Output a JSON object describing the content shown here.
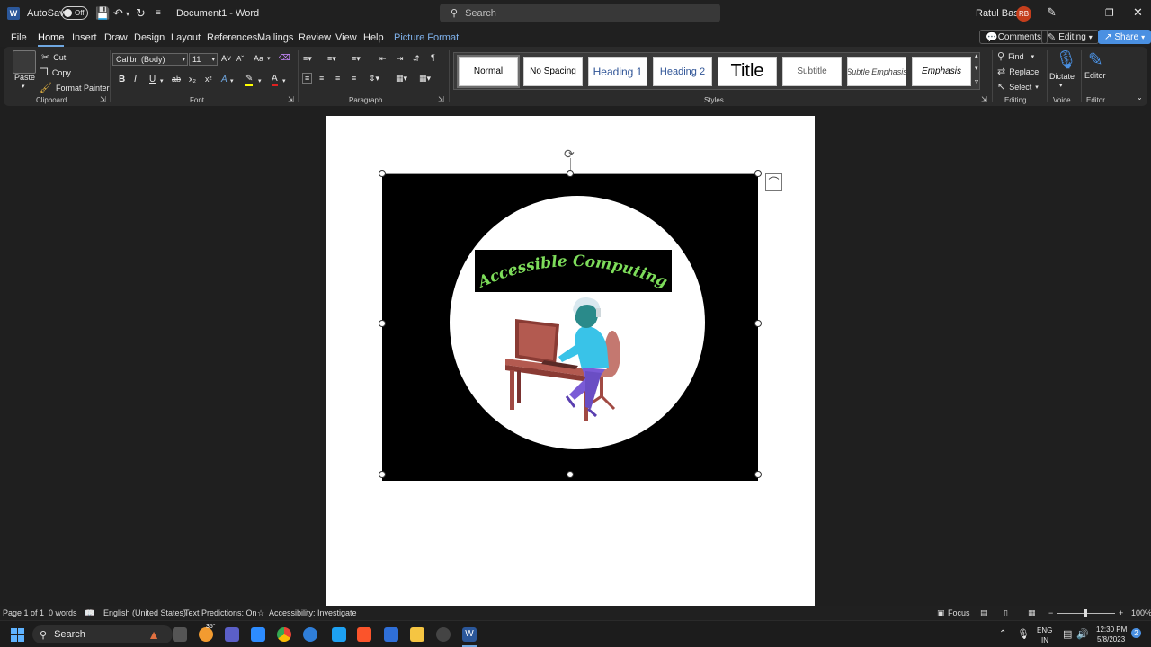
{
  "titlebar": {
    "app_logo": "W",
    "autosave_label": "AutoSave",
    "autosave_state": "Off",
    "document_title": "Document1  -  Word",
    "search_placeholder": "Search",
    "user_name": "Ratul Basak",
    "user_initials": "RB"
  },
  "menu": {
    "tabs": [
      "File",
      "Home",
      "Insert",
      "Draw",
      "Design",
      "Layout",
      "References",
      "Mailings",
      "Review",
      "View",
      "Help",
      "Picture Format"
    ],
    "active_tab": "Home",
    "comments_label": "Comments",
    "editing_label": "Editing",
    "share_label": "Share"
  },
  "ribbon": {
    "clipboard": {
      "paste": "Paste",
      "cut": "Cut",
      "copy": "Copy",
      "format_painter": "Format Painter",
      "label": "Clipboard"
    },
    "font": {
      "family": "Calibri (Body)",
      "size": "11",
      "label": "Font",
      "bold": "B",
      "italic": "I",
      "underline": "U",
      "strike": "ab",
      "sub": "x₂",
      "sup": "x²",
      "aa": "Aa"
    },
    "paragraph": {
      "label": "Paragraph"
    },
    "styles": {
      "label": "Styles",
      "items": [
        "Normal",
        "No Spacing",
        "Heading 1",
        "Heading 2",
        "Title",
        "Subtitle",
        "Subtle Emphasis",
        "Emphasis"
      ]
    },
    "editing": {
      "find": "Find",
      "replace": "Replace",
      "select": "Select",
      "label": "Editing"
    },
    "voice": {
      "dictate": "Dictate",
      "label": "Voice"
    },
    "editor": {
      "editor": "Editor",
      "label": "Editor"
    }
  },
  "picture": {
    "banner_text": "Accessible Computing"
  },
  "statusbar": {
    "page": "Page 1 of 1",
    "words": "0 words",
    "language": "English (United States)",
    "predictions": "Text Predictions: On",
    "accessibility": "Accessibility: Investigate",
    "focus": "Focus",
    "zoom": "100%"
  },
  "taskbar": {
    "search": "Search",
    "weather": "35°",
    "lang_top": "ENG",
    "lang_bottom": "IN",
    "time": "12:30 PM",
    "date": "5/8/2023",
    "notification_count": "2"
  }
}
